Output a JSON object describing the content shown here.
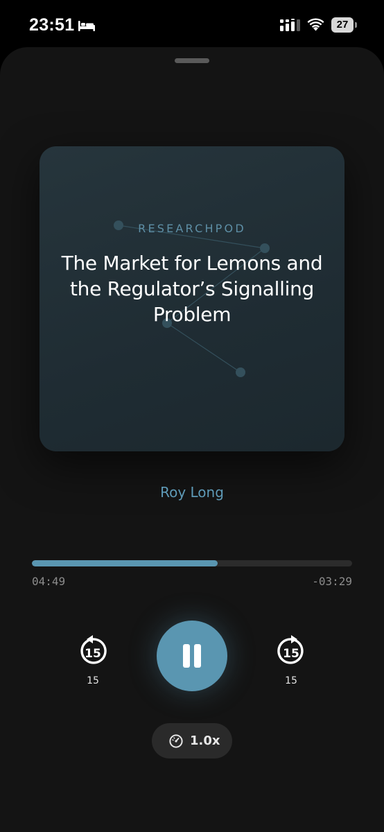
{
  "status_bar": {
    "time": "23:51",
    "battery": "27"
  },
  "artwork": {
    "kicker": "RESEARCHPOD",
    "title": "The Market for Lemons and the Regulator’s Signalling Problem"
  },
  "author": "Roy Long",
  "player": {
    "progress_fraction": 0.58,
    "elapsed": "04:49",
    "remaining": "-03:29",
    "skip_back_label": "15",
    "skip_forward_label": "15",
    "skip_back_number": "15",
    "skip_forward_number": "15",
    "speed": "1.0x"
  },
  "colors": {
    "accent": "#5a96b1",
    "background": "#141414",
    "artwork": "#26353c"
  },
  "icons": {
    "bed": "bed-icon",
    "signal": "cellular-signal-icon",
    "wifi": "wifi-icon",
    "skip_back": "skip-back-15-icon",
    "skip_forward": "skip-forward-15-icon",
    "pause": "pause-icon",
    "speed": "speedometer-icon"
  }
}
